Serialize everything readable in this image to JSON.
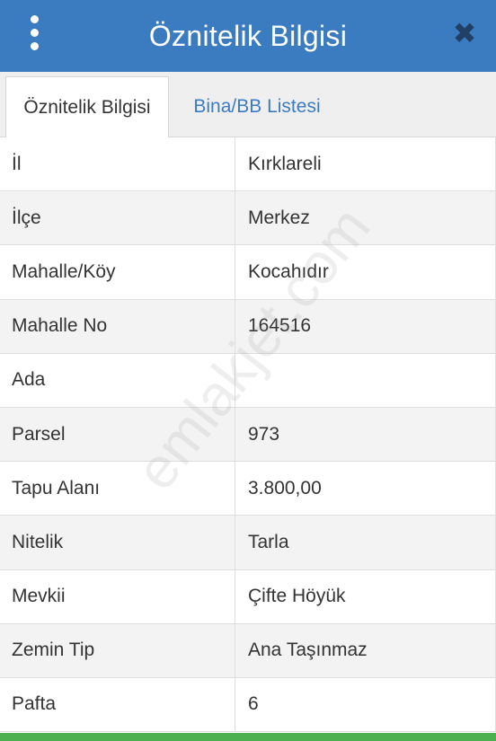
{
  "header": {
    "title": "Öznitelik Bilgisi",
    "close_glyph": "✖",
    "menu_icon": "kebab-menu-icon",
    "close_icon": "close-icon"
  },
  "tabs": [
    {
      "label": "Öznitelik Bilgisi",
      "active": true
    },
    {
      "label": "Bina/BB Listesi",
      "active": false
    }
  ],
  "rows": [
    {
      "key": "İl",
      "value": "Kırklareli"
    },
    {
      "key": "İlçe",
      "value": "Merkez"
    },
    {
      "key": "Mahalle/Köy",
      "value": "Kocahıdır"
    },
    {
      "key": "Mahalle No",
      "value": "164516"
    },
    {
      "key": "Ada",
      "value": ""
    },
    {
      "key": "Parsel",
      "value": "973"
    },
    {
      "key": "Tapu Alanı",
      "value": "3.800,00"
    },
    {
      "key": "Nitelik",
      "value": "Tarla"
    },
    {
      "key": "Mevkii",
      "value": "Çifte Höyük"
    },
    {
      "key": "Zemin Tip",
      "value": "Ana Taşınmaz"
    },
    {
      "key": "Pafta",
      "value": "6"
    }
  ],
  "watermark": "emlakjet.com",
  "colors": {
    "header_bg": "#3b7cc0",
    "tab_link": "#3b7cc0",
    "footer_bar": "#4caf50"
  }
}
